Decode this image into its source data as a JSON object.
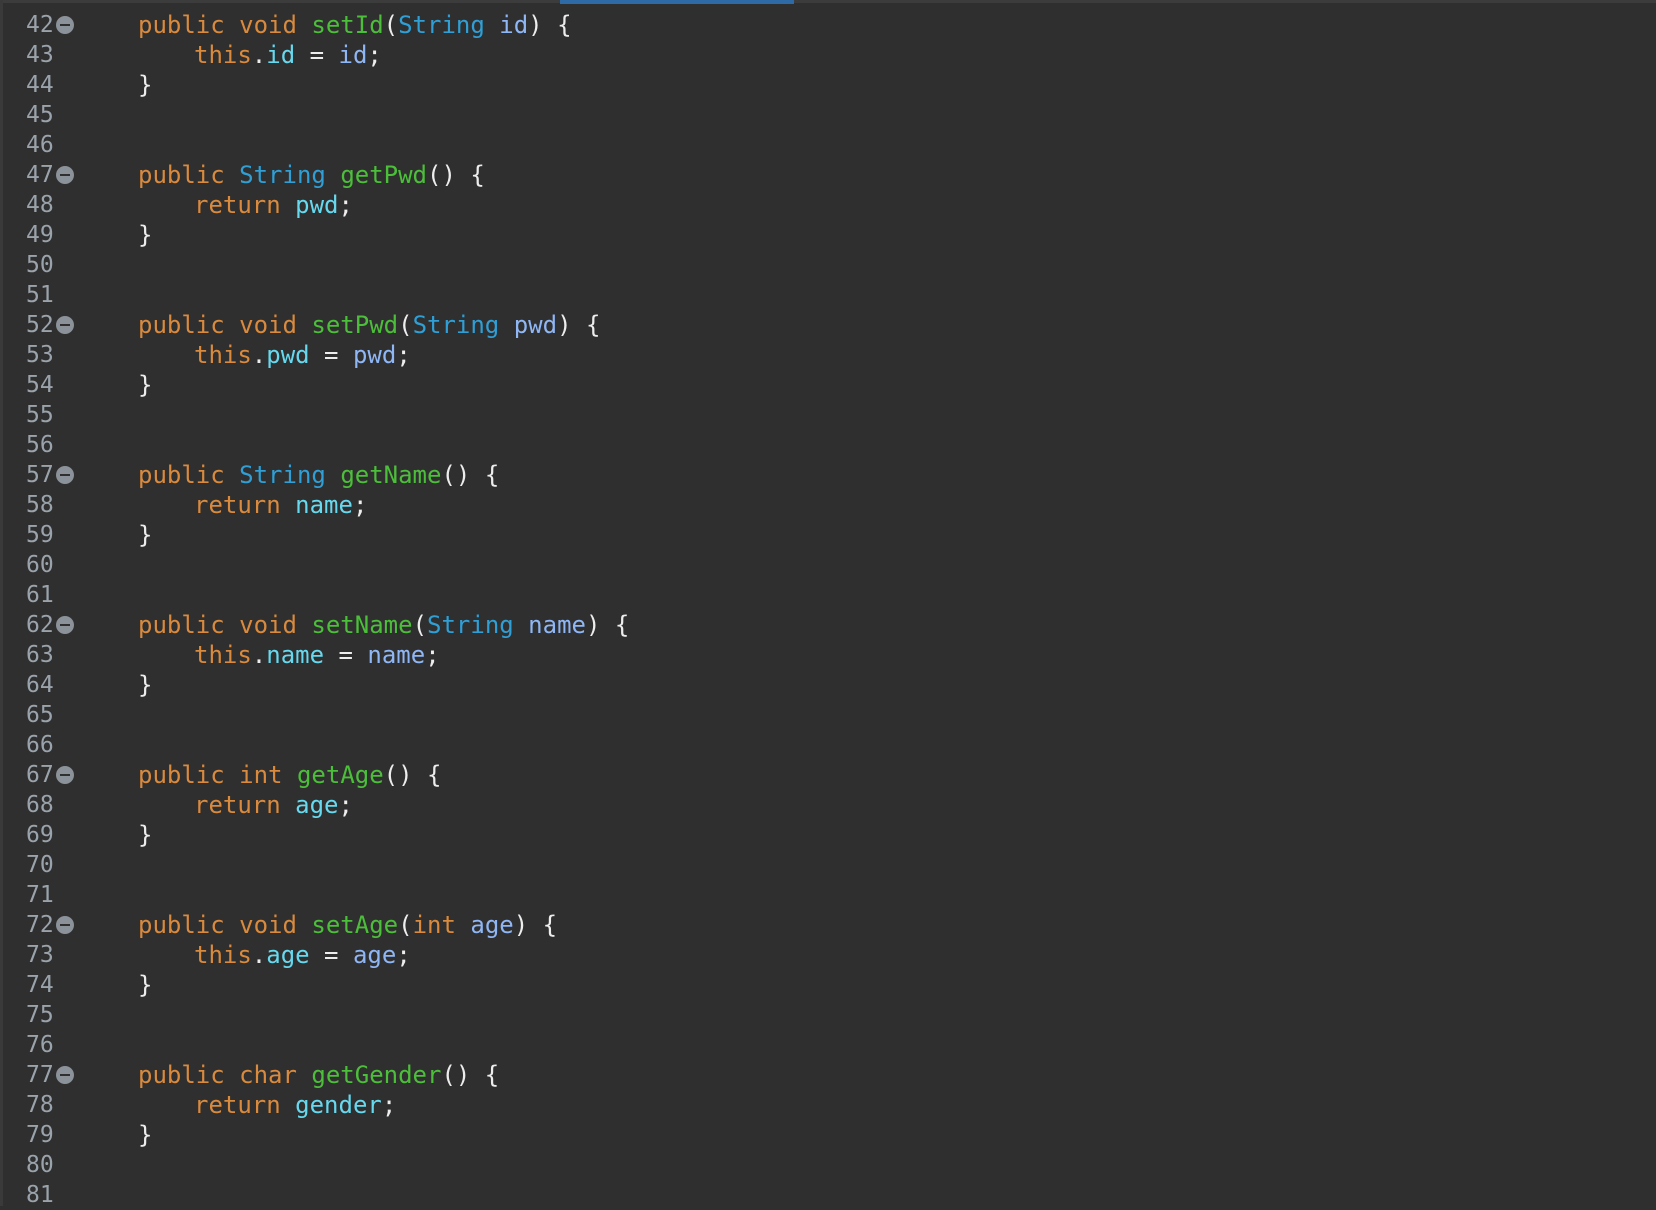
{
  "editor": {
    "language": "java",
    "colors": {
      "background": "#2f2f2f",
      "line_number": "#9aa3ab",
      "keyword": "#d98a3d",
      "type": "#2f9fd6",
      "method": "#4cbf3a",
      "field": "#66d9ef",
      "parameter": "#8fb6f5",
      "punctuation": "#ededed",
      "fold_marker": "#8b9299",
      "scroll_indicator": "#2d6aa6"
    },
    "lines": [
      {
        "n": "42",
        "fold": true,
        "indent": 1,
        "tokens": [
          [
            "public",
            "kw"
          ],
          [
            " ",
            "pn"
          ],
          [
            "void",
            "kw"
          ],
          [
            " ",
            "pn"
          ],
          [
            "setId",
            "fn"
          ],
          [
            "(",
            "pn"
          ],
          [
            "String",
            "typ"
          ],
          [
            " ",
            "pn"
          ],
          [
            "id",
            "prm"
          ],
          [
            ") {",
            "pn"
          ]
        ]
      },
      {
        "n": "43",
        "fold": false,
        "indent": 2,
        "tokens": [
          [
            "this",
            "kw"
          ],
          [
            ".",
            "pn"
          ],
          [
            "id",
            "fld"
          ],
          [
            " = ",
            "pn"
          ],
          [
            "id",
            "prm"
          ],
          [
            ";",
            "pn"
          ]
        ]
      },
      {
        "n": "44",
        "fold": false,
        "indent": 1,
        "tokens": [
          [
            "}",
            "pn"
          ]
        ]
      },
      {
        "n": "45",
        "fold": false,
        "indent": 0,
        "tokens": []
      },
      {
        "n": "46",
        "fold": false,
        "indent": 0,
        "tokens": []
      },
      {
        "n": "47",
        "fold": true,
        "indent": 1,
        "tokens": [
          [
            "public",
            "kw"
          ],
          [
            " ",
            "pn"
          ],
          [
            "String",
            "typ"
          ],
          [
            " ",
            "pn"
          ],
          [
            "getPwd",
            "fn"
          ],
          [
            "() {",
            "pn"
          ]
        ]
      },
      {
        "n": "48",
        "fold": false,
        "indent": 2,
        "tokens": [
          [
            "return",
            "kw"
          ],
          [
            " ",
            "pn"
          ],
          [
            "pwd",
            "fld"
          ],
          [
            ";",
            "pn"
          ]
        ]
      },
      {
        "n": "49",
        "fold": false,
        "indent": 1,
        "tokens": [
          [
            "}",
            "pn"
          ]
        ]
      },
      {
        "n": "50",
        "fold": false,
        "indent": 0,
        "tokens": []
      },
      {
        "n": "51",
        "fold": false,
        "indent": 0,
        "tokens": []
      },
      {
        "n": "52",
        "fold": true,
        "indent": 1,
        "tokens": [
          [
            "public",
            "kw"
          ],
          [
            " ",
            "pn"
          ],
          [
            "void",
            "kw"
          ],
          [
            " ",
            "pn"
          ],
          [
            "setPwd",
            "fn"
          ],
          [
            "(",
            "pn"
          ],
          [
            "String",
            "typ"
          ],
          [
            " ",
            "pn"
          ],
          [
            "pwd",
            "prm"
          ],
          [
            ") {",
            "pn"
          ]
        ]
      },
      {
        "n": "53",
        "fold": false,
        "indent": 2,
        "tokens": [
          [
            "this",
            "kw"
          ],
          [
            ".",
            "pn"
          ],
          [
            "pwd",
            "fld"
          ],
          [
            " = ",
            "pn"
          ],
          [
            "pwd",
            "prm"
          ],
          [
            ";",
            "pn"
          ]
        ]
      },
      {
        "n": "54",
        "fold": false,
        "indent": 1,
        "tokens": [
          [
            "}",
            "pn"
          ]
        ]
      },
      {
        "n": "55",
        "fold": false,
        "indent": 0,
        "tokens": []
      },
      {
        "n": "56",
        "fold": false,
        "indent": 0,
        "tokens": []
      },
      {
        "n": "57",
        "fold": true,
        "indent": 1,
        "tokens": [
          [
            "public",
            "kw"
          ],
          [
            " ",
            "pn"
          ],
          [
            "String",
            "typ"
          ],
          [
            " ",
            "pn"
          ],
          [
            "getName",
            "fn"
          ],
          [
            "() {",
            "pn"
          ]
        ]
      },
      {
        "n": "58",
        "fold": false,
        "indent": 2,
        "tokens": [
          [
            "return",
            "kw"
          ],
          [
            " ",
            "pn"
          ],
          [
            "name",
            "fld"
          ],
          [
            ";",
            "pn"
          ]
        ]
      },
      {
        "n": "59",
        "fold": false,
        "indent": 1,
        "tokens": [
          [
            "}",
            "pn"
          ]
        ]
      },
      {
        "n": "60",
        "fold": false,
        "indent": 0,
        "tokens": []
      },
      {
        "n": "61",
        "fold": false,
        "indent": 0,
        "tokens": []
      },
      {
        "n": "62",
        "fold": true,
        "indent": 1,
        "tokens": [
          [
            "public",
            "kw"
          ],
          [
            " ",
            "pn"
          ],
          [
            "void",
            "kw"
          ],
          [
            " ",
            "pn"
          ],
          [
            "setName",
            "fn"
          ],
          [
            "(",
            "pn"
          ],
          [
            "String",
            "typ"
          ],
          [
            " ",
            "pn"
          ],
          [
            "name",
            "prm"
          ],
          [
            ") {",
            "pn"
          ]
        ]
      },
      {
        "n": "63",
        "fold": false,
        "indent": 2,
        "tokens": [
          [
            "this",
            "kw"
          ],
          [
            ".",
            "pn"
          ],
          [
            "name",
            "fld"
          ],
          [
            " = ",
            "pn"
          ],
          [
            "name",
            "prm"
          ],
          [
            ";",
            "pn"
          ]
        ]
      },
      {
        "n": "64",
        "fold": false,
        "indent": 1,
        "tokens": [
          [
            "}",
            "pn"
          ]
        ]
      },
      {
        "n": "65",
        "fold": false,
        "indent": 0,
        "tokens": []
      },
      {
        "n": "66",
        "fold": false,
        "indent": 0,
        "tokens": []
      },
      {
        "n": "67",
        "fold": true,
        "indent": 1,
        "tokens": [
          [
            "public",
            "kw"
          ],
          [
            " ",
            "pn"
          ],
          [
            "int",
            "kw"
          ],
          [
            " ",
            "pn"
          ],
          [
            "getAge",
            "fn"
          ],
          [
            "() {",
            "pn"
          ]
        ]
      },
      {
        "n": "68",
        "fold": false,
        "indent": 2,
        "tokens": [
          [
            "return",
            "kw"
          ],
          [
            " ",
            "pn"
          ],
          [
            "age",
            "fld"
          ],
          [
            ";",
            "pn"
          ]
        ]
      },
      {
        "n": "69",
        "fold": false,
        "indent": 1,
        "tokens": [
          [
            "}",
            "pn"
          ]
        ]
      },
      {
        "n": "70",
        "fold": false,
        "indent": 0,
        "tokens": []
      },
      {
        "n": "71",
        "fold": false,
        "indent": 0,
        "tokens": []
      },
      {
        "n": "72",
        "fold": true,
        "indent": 1,
        "tokens": [
          [
            "public",
            "kw"
          ],
          [
            " ",
            "pn"
          ],
          [
            "void",
            "kw"
          ],
          [
            " ",
            "pn"
          ],
          [
            "setAge",
            "fn"
          ],
          [
            "(",
            "pn"
          ],
          [
            "int",
            "kw"
          ],
          [
            " ",
            "pn"
          ],
          [
            "age",
            "prm"
          ],
          [
            ") {",
            "pn"
          ]
        ]
      },
      {
        "n": "73",
        "fold": false,
        "indent": 2,
        "tokens": [
          [
            "this",
            "kw"
          ],
          [
            ".",
            "pn"
          ],
          [
            "age",
            "fld"
          ],
          [
            " = ",
            "pn"
          ],
          [
            "age",
            "prm"
          ],
          [
            ";",
            "pn"
          ]
        ]
      },
      {
        "n": "74",
        "fold": false,
        "indent": 1,
        "tokens": [
          [
            "}",
            "pn"
          ]
        ]
      },
      {
        "n": "75",
        "fold": false,
        "indent": 0,
        "tokens": []
      },
      {
        "n": "76",
        "fold": false,
        "indent": 0,
        "tokens": []
      },
      {
        "n": "77",
        "fold": true,
        "indent": 1,
        "tokens": [
          [
            "public",
            "kw"
          ],
          [
            " ",
            "pn"
          ],
          [
            "char",
            "kw"
          ],
          [
            " ",
            "pn"
          ],
          [
            "getGender",
            "fn"
          ],
          [
            "() {",
            "pn"
          ]
        ]
      },
      {
        "n": "78",
        "fold": false,
        "indent": 2,
        "tokens": [
          [
            "return",
            "kw"
          ],
          [
            " ",
            "pn"
          ],
          [
            "gender",
            "fld"
          ],
          [
            ";",
            "pn"
          ]
        ]
      },
      {
        "n": "79",
        "fold": false,
        "indent": 1,
        "tokens": [
          [
            "}",
            "pn"
          ]
        ]
      },
      {
        "n": "80",
        "fold": false,
        "indent": 0,
        "tokens": []
      },
      {
        "n": "81",
        "fold": false,
        "indent": 0,
        "tokens": []
      }
    ]
  }
}
